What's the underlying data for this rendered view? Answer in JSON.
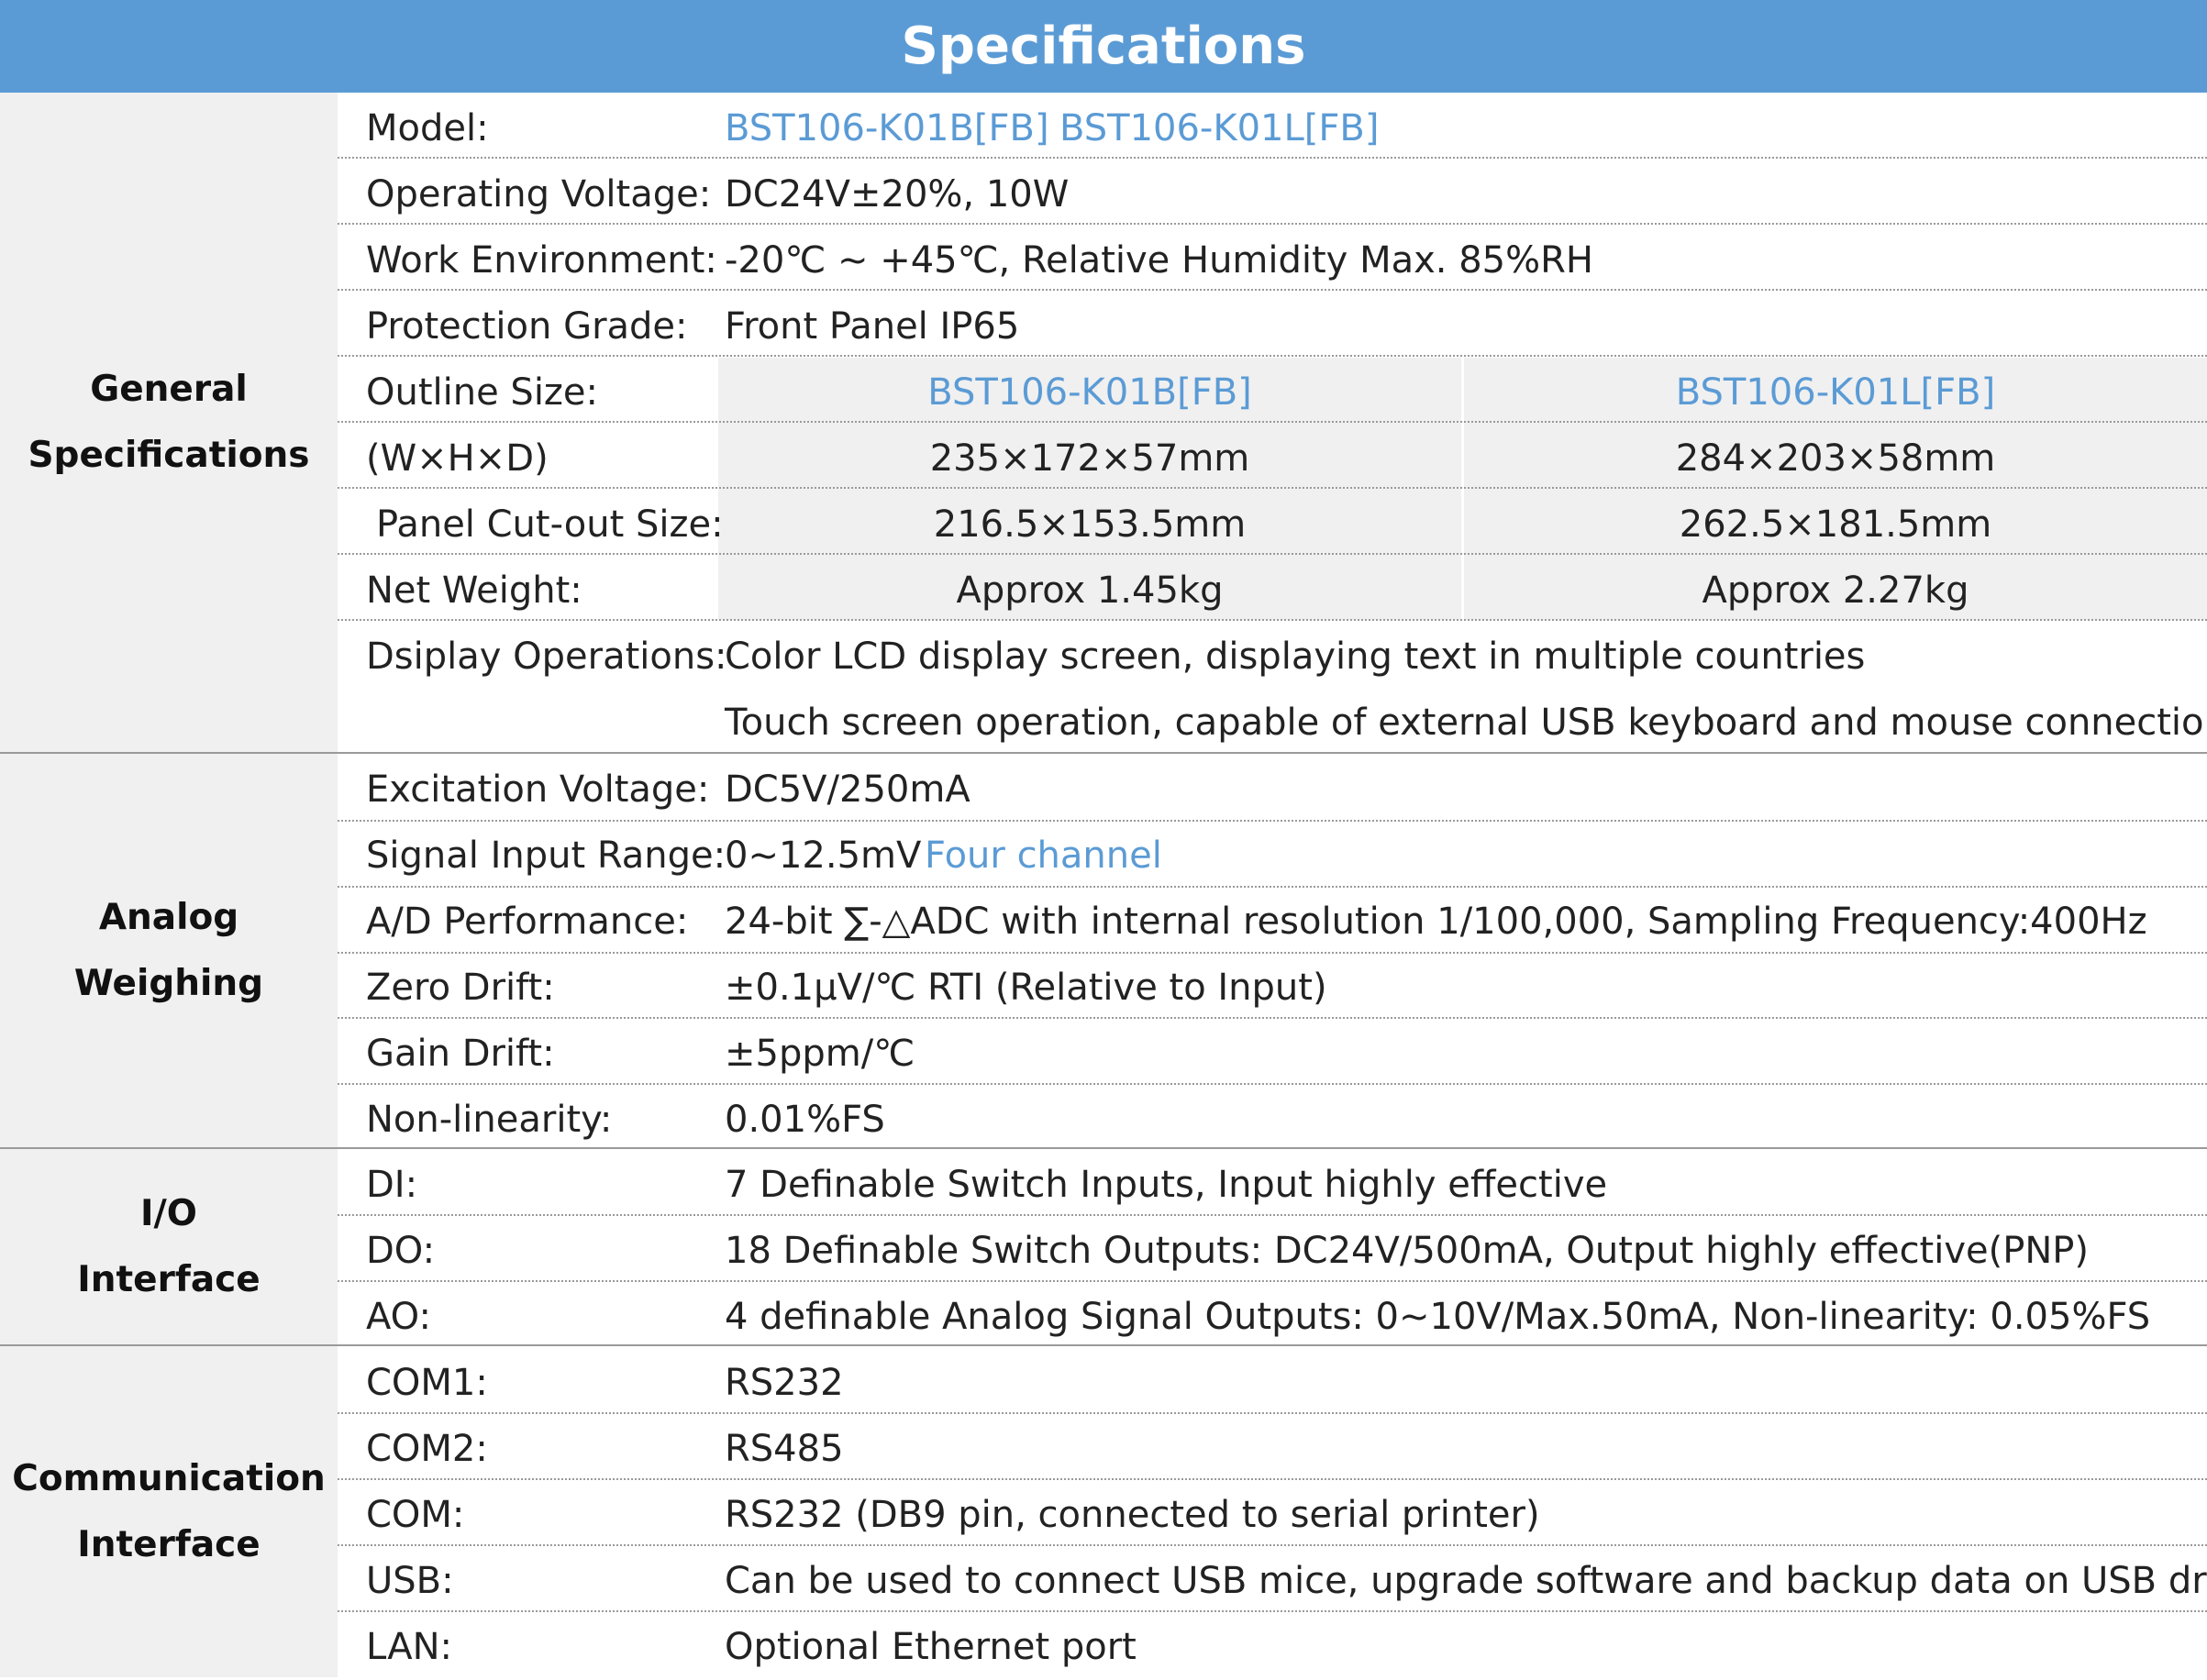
{
  "title": "Specifications",
  "colors": {
    "header_bg": "#5b9bd5",
    "accent": "#5b9bd5",
    "group_bg": "#f0f0f0"
  },
  "groups": [
    {
      "label_lines": [
        "General",
        "Specifications"
      ]
    },
    {
      "label_lines": [
        "Analog",
        "Weighing"
      ]
    },
    {
      "label_lines": [
        "I/O",
        "Interface"
      ]
    },
    {
      "label_lines": [
        "Communication",
        "Interface"
      ]
    }
  ],
  "general": {
    "model_label": "Model:",
    "model_a": "BST106-K01B[FB]",
    "model_b": "BST106-K01L[FB]",
    "voltage_label": "Operating Voltage:",
    "voltage_value": "DC24V±20%, 10W",
    "env_label": "Work Environment:",
    "env_value": "-20℃ ~ +45℃, Relative Humidity Max. 85%RH",
    "protection_label": "Protection Grade:",
    "protection_value": "Front Panel  IP65",
    "outline_label": "Outline Size:",
    "outline_head_a": "BST106-K01B[FB]",
    "outline_head_b": "BST106-K01L[FB]",
    "whd_label": "(W×H×D)",
    "whd_a": "235×172×57mm",
    "whd_b": "284×203×58mm",
    "cutout_label": "Panel Cut-out Size:",
    "cutout_a": "216.5×153.5mm",
    "cutout_b": "262.5×181.5mm",
    "weight_label": "Net Weight:",
    "weight_a": "Approx 1.45kg",
    "weight_b": "Approx 2.27kg",
    "display_label": "Dsiplay Operations:",
    "display_line1": "Color LCD display screen, displaying text in multiple countries",
    "display_line2": "Touch screen operation, capable of external USB keyboard and mouse connection"
  },
  "analog": {
    "excitation_label": "Excitation Voltage:",
    "excitation_value": "DC5V/250mA",
    "signal_label": "Signal Input Range:",
    "signal_value": "0~12.5mV",
    "signal_channel": "Four  channel",
    "ad_label": "A/D Performance:",
    "ad_value": "24-bit ∑-△ADC with internal resolution 1/100,000,  Sampling Frequency:400Hz",
    "zero_label": "Zero Drift:",
    "zero_value": "±0.1μV/℃ RTI (Relative to Input)",
    "gain_label": "Gain Drift:",
    "gain_value": "±5ppm/℃",
    "nonlin_label": "Non-linearity:",
    "nonlin_value": "0.01%FS"
  },
  "io": {
    "di_label": "DI:",
    "di_value": "7 Definable  Switch Inputs,  Input highly effective",
    "do_label": "DO:",
    "do_value": "18 Definable  Switch Outputs: DC24V/500mA,  Output highly effective(PNP)",
    "ao_label": "AO:",
    "ao_value": "4 definable Analog Signal Outputs: 0~10V/Max.50mA,   Non-linearity: 0.05%FS"
  },
  "comm": {
    "com1_label": "COM1:",
    "com1_value": "RS232",
    "com2_label": "COM2:",
    "com2_value": "RS485",
    "com_label": "COM:",
    "com_value": "RS232 (DB9 pin, connected to serial printer)",
    "usb_label": "USB:",
    "usb_value": "Can be used to connect USB mice, upgrade software  and backup data on USB drives",
    "lan_label": "LAN:",
    "lan_value": "Optional Ethernet port"
  }
}
